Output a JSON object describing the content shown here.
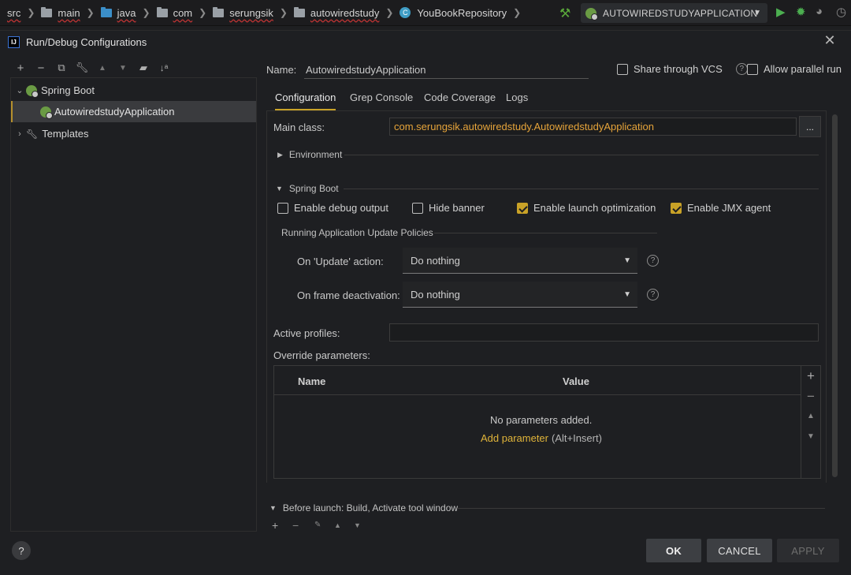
{
  "breadcrumb": [
    {
      "label": "src",
      "icon": "none"
    },
    {
      "label": "main",
      "icon": "folder-icon"
    },
    {
      "label": "java",
      "icon": "folder-blue-icon"
    },
    {
      "label": "com",
      "icon": "folder-icon"
    },
    {
      "label": "serungsik",
      "icon": "folder-icon"
    },
    {
      "label": "autowiredstudy",
      "icon": "folder-icon"
    },
    {
      "label": "YouBookRepository",
      "icon": "class-icon"
    }
  ],
  "run_config": {
    "label": "AUTOWIREDSTUDYAPPLICATION"
  },
  "dialog": {
    "title": "Run/Debug Configurations",
    "logo_text": "IJ"
  },
  "tree": {
    "spring_boot": "Spring Boot",
    "app": "AutowiredstudyApplication",
    "templates": "Templates"
  },
  "form": {
    "name_label": "Name:",
    "name_value": "AutowiredstudyApplication",
    "share_vcs": "Share through VCS",
    "allow_parallel": "Allow parallel run",
    "tabs": [
      "Configuration",
      "Grep Console",
      "Code Coverage",
      "Logs"
    ],
    "main_class_label": "Main class:",
    "main_class_value": "com.serungsik.autowiredstudy.AutowiredstudyApplication",
    "browse": "...",
    "environment": "Environment",
    "spring_boot_section": "Spring Boot",
    "enable_debug": "Enable debug output",
    "hide_banner": "Hide banner",
    "enable_launch": "Enable launch optimization",
    "enable_jmx": "Enable JMX agent",
    "update_policies": "Running Application Update Policies",
    "on_update_label": "On 'Update' action:",
    "on_update_value": "Do nothing",
    "on_frame_label": "On frame deactivation:",
    "on_frame_value": "Do nothing",
    "active_profiles": "Active profiles:",
    "override_params": "Override parameters:",
    "col_name": "Name",
    "col_value": "Value",
    "no_params": "No parameters added.",
    "add_param": "Add parameter",
    "add_param_shortcut": "(Alt+Insert)",
    "before_launch": "Before launch: Build, Activate tool window"
  },
  "buttons": {
    "ok": "OK",
    "cancel": "CANCEL",
    "apply": "APPLY",
    "help": "?"
  },
  "colors": {
    "accent": "#c9a227",
    "main_class": "#e6a43a"
  }
}
